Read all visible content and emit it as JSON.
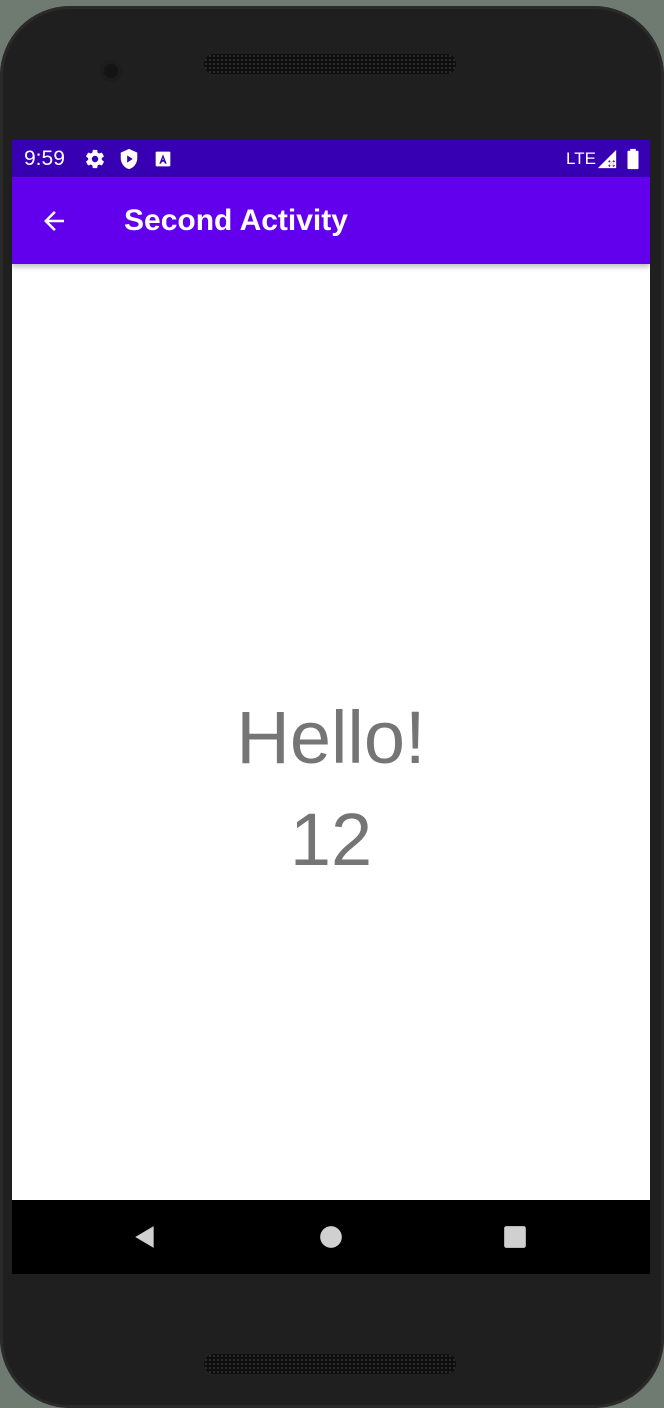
{
  "status_bar": {
    "time": "9:59",
    "network": "LTE",
    "icons": [
      "settings-icon",
      "shield-play-icon",
      "a-badge-icon",
      "signal-icon",
      "battery-icon"
    ],
    "background": "#3700b3"
  },
  "app_bar": {
    "title": "Second Activity",
    "back_icon": "arrow-back-icon",
    "background": "#6200ee"
  },
  "content": {
    "greeting": "Hello!",
    "count": "12",
    "text_color": "#757575"
  },
  "nav_bar": {
    "buttons": [
      "back-triangle-icon",
      "home-circle-icon",
      "recents-square-icon"
    ],
    "background": "#000000"
  }
}
